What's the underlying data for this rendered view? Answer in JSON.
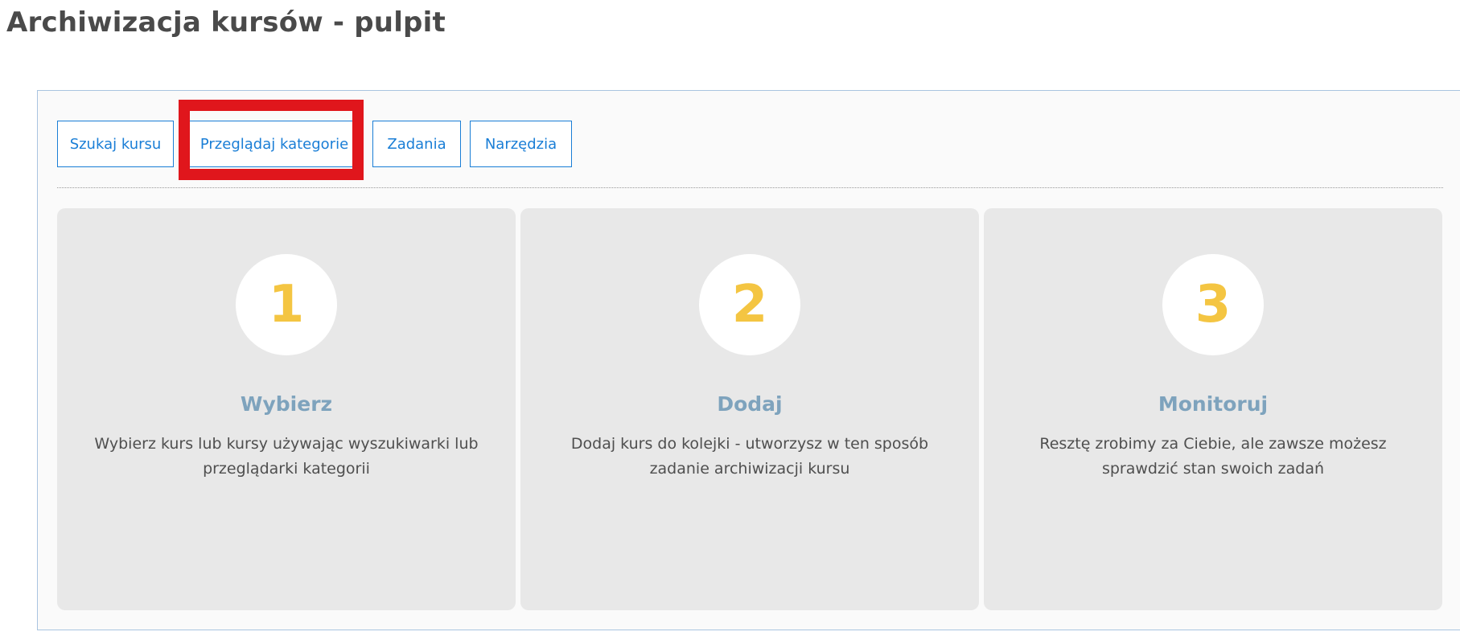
{
  "page": {
    "title": "Archiwizacja kursów - pulpit"
  },
  "tabs": {
    "search": "Szukaj kursu",
    "browse": "Przeglądaj kategorie",
    "tasks": "Zadania",
    "tools": "Narzędzia"
  },
  "steps": [
    {
      "number": "1",
      "title": "Wybierz",
      "description": "Wybierz kurs lub kursy używając wyszukiwarki lub przeglądarki kategorii"
    },
    {
      "number": "2",
      "title": "Dodaj",
      "description": "Dodaj kurs do kolejki - utworzysz w ten sposób zadanie archiwizacji kursu"
    },
    {
      "number": "3",
      "title": "Monitoruj",
      "description": "Resztę zrobimy za Ciebie, ale zawsze możesz sprawdzić stan swoich zadań"
    }
  ],
  "colors": {
    "accent": "#1a7ed6",
    "step_number": "#f4c542",
    "step_title": "#7ea3bd",
    "highlight": "#e0161c",
    "card_background": "#e8e8e8"
  }
}
